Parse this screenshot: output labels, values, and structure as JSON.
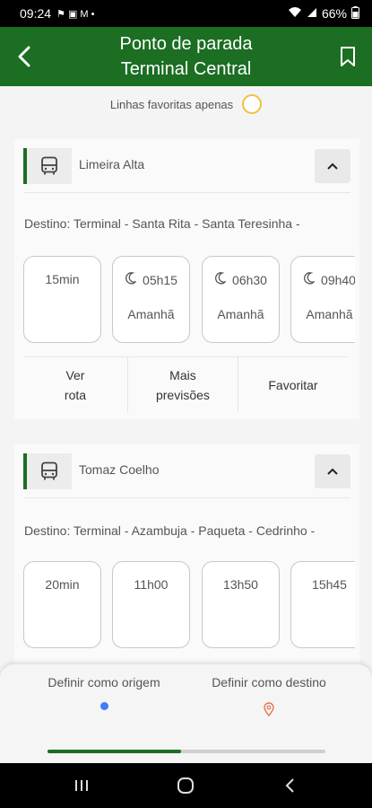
{
  "status_bar": {
    "time": "09:24",
    "battery": "66%"
  },
  "header": {
    "title_line1": "Ponto de parada",
    "title_line2": "Terminal Central"
  },
  "favorites_filter": {
    "label": "Linhas favoritas apenas"
  },
  "cards": [
    {
      "line_name": "Limeira Alta",
      "destination": "Destino: Terminal - Santa Rita - Santa Teresinha -",
      "times": [
        {
          "time": "15min",
          "day": ""
        },
        {
          "time": "05h15",
          "day": "Amanhã"
        },
        {
          "time": "06h30",
          "day": "Amanhã"
        },
        {
          "time": "09h40",
          "day": "Amanhã"
        }
      ],
      "actions": {
        "route": "Ver rota",
        "more": "Mais previsões",
        "favorite": "Favoritar"
      }
    },
    {
      "line_name": "Tomaz Coelho",
      "destination": "Destino: Terminal - Azambuja - Paqueta - Cedrinho -",
      "times": [
        {
          "time": "20min",
          "day": ""
        },
        {
          "time": "11h00",
          "day": ""
        },
        {
          "time": "13h50",
          "day": ""
        },
        {
          "time": "15h45",
          "day": ""
        }
      ]
    }
  ],
  "bottom_panel": {
    "origin_label": "Definir como origem",
    "destination_label": "Definir como destino"
  },
  "carousel_progress": 0.48,
  "colors": {
    "primary": "#1b6e22",
    "toggle": "#f0c040",
    "origin": "#3d7ef5",
    "destination": "#e8744a"
  }
}
